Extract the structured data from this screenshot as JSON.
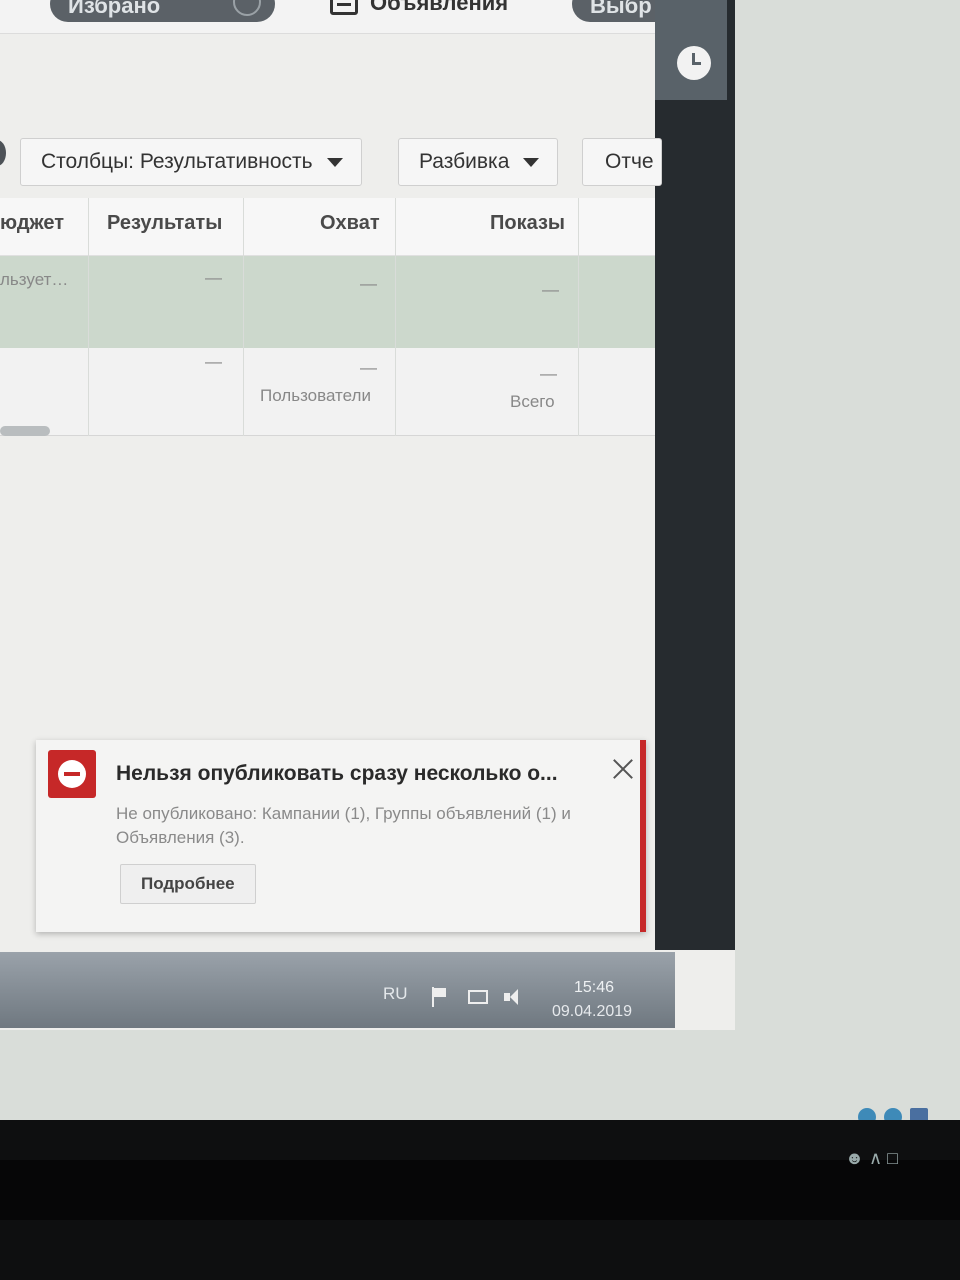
{
  "top_tabs": {
    "favorites_label": "Избрано",
    "ads_label": "Объявления",
    "select_label": "Выбр"
  },
  "toolbar": {
    "columns_label": "Столбцы: Результативность",
    "breakdown_label": "Разбивка",
    "reports_label": "Отче"
  },
  "table": {
    "headers": [
      "юджет",
      "Результаты",
      "Охват",
      "Показы"
    ],
    "rows": [
      {
        "budget": "льзует…",
        "results": "—",
        "reach": "—",
        "impressions": "—"
      },
      {
        "budget": "",
        "results": "—",
        "reach": "—",
        "reach_note": "Пользователи",
        "impressions": "—",
        "impressions_note": "Всего"
      }
    ]
  },
  "notification": {
    "icon": "no-entry-icon",
    "title": "Нельзя опубликовать сразу несколько о...",
    "body": "Не опубликовано: Кампании (1), Группы объявлений (1) и Объявления (3).",
    "details_label": "Подробнее"
  },
  "taskbar": {
    "lang": "RU",
    "time": "15:46",
    "date": "09.04.2019"
  },
  "colors": {
    "accent_red": "#c62828",
    "sidebar_dark": "#262b2f",
    "row_highlight": "#ccd8cc"
  }
}
